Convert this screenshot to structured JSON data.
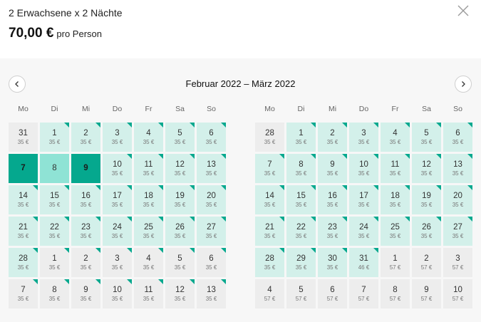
{
  "header": {
    "guests": "2 Erwachsene x 2 Nächte",
    "price": "70,00 €",
    "per": "pro Person"
  },
  "calendar": {
    "range_title": "Februar 2022 – März 2022",
    "weekdays": [
      "Mo",
      "Di",
      "Mi",
      "Do",
      "Fr",
      "Sa",
      "So"
    ]
  },
  "icons": {
    "close": "close-icon",
    "prev": "chevron-left-icon",
    "next": "chevron-right-icon"
  },
  "colors": {
    "accent": "#05a88e",
    "selected_mid": "#8fe3d5",
    "available": "#d3f0ea",
    "inactive": "#ededed"
  },
  "legend_types": {
    "a": "available",
    "n": "other month / unavailable",
    "s": "selected start/end",
    "m": "selected middle"
  },
  "months": [
    {
      "days": [
        [
          "31",
          "35 €",
          "n"
        ],
        [
          "1",
          "35 €",
          "a"
        ],
        [
          "2",
          "35 €",
          "a"
        ],
        [
          "3",
          "35 €",
          "a"
        ],
        [
          "4",
          "35 €",
          "a"
        ],
        [
          "5",
          "35 €",
          "a"
        ],
        [
          "6",
          "35 €",
          "a"
        ],
        [
          "7",
          "",
          "s"
        ],
        [
          "8",
          "",
          "m"
        ],
        [
          "9",
          "",
          "s"
        ],
        [
          "10",
          "35 €",
          "a"
        ],
        [
          "11",
          "35 €",
          "a"
        ],
        [
          "12",
          "35 €",
          "a"
        ],
        [
          "13",
          "35 €",
          "a"
        ],
        [
          "14",
          "35 €",
          "a"
        ],
        [
          "15",
          "35 €",
          "a"
        ],
        [
          "16",
          "35 €",
          "a"
        ],
        [
          "17",
          "35 €",
          "a"
        ],
        [
          "18",
          "35 €",
          "a"
        ],
        [
          "19",
          "35 €",
          "a"
        ],
        [
          "20",
          "35 €",
          "a"
        ],
        [
          "21",
          "35 €",
          "a"
        ],
        [
          "22",
          "35 €",
          "a"
        ],
        [
          "23",
          "35 €",
          "a"
        ],
        [
          "24",
          "35 €",
          "a"
        ],
        [
          "25",
          "35 €",
          "a"
        ],
        [
          "26",
          "35 €",
          "a"
        ],
        [
          "27",
          "35 €",
          "a"
        ],
        [
          "28",
          "35 €",
          "a"
        ],
        [
          "1",
          "35 €",
          "n"
        ],
        [
          "2",
          "35 €",
          "n"
        ],
        [
          "3",
          "35 €",
          "n"
        ],
        [
          "4",
          "35 €",
          "n"
        ],
        [
          "5",
          "35 €",
          "n"
        ],
        [
          "6",
          "35 €",
          "n"
        ],
        [
          "7",
          "35 €",
          "n"
        ],
        [
          "8",
          "35 €",
          "n"
        ],
        [
          "9",
          "35 €",
          "n"
        ],
        [
          "10",
          "35 €",
          "n"
        ],
        [
          "11",
          "35 €",
          "n"
        ],
        [
          "12",
          "35 €",
          "n"
        ],
        [
          "13",
          "35 €",
          "n"
        ]
      ],
      "triangles": [
        1,
        2,
        3,
        4,
        5,
        6,
        10,
        11,
        12,
        13,
        14,
        15,
        16,
        17,
        18,
        19,
        20,
        21,
        22,
        23,
        24,
        25,
        26,
        27,
        28,
        29,
        30,
        31,
        32,
        33,
        34,
        35,
        36,
        37,
        38,
        39,
        40,
        41
      ]
    },
    {
      "days": [
        [
          "28",
          "35 €",
          "n"
        ],
        [
          "1",
          "35 €",
          "a"
        ],
        [
          "2",
          "35 €",
          "a"
        ],
        [
          "3",
          "35 €",
          "a"
        ],
        [
          "4",
          "35 €",
          "a"
        ],
        [
          "5",
          "35 €",
          "a"
        ],
        [
          "6",
          "35 €",
          "a"
        ],
        [
          "7",
          "35 €",
          "a"
        ],
        [
          "8",
          "35 €",
          "a"
        ],
        [
          "9",
          "35 €",
          "a"
        ],
        [
          "10",
          "35 €",
          "a"
        ],
        [
          "11",
          "35 €",
          "a"
        ],
        [
          "12",
          "35 €",
          "a"
        ],
        [
          "13",
          "35 €",
          "a"
        ],
        [
          "14",
          "35 €",
          "a"
        ],
        [
          "15",
          "35 €",
          "a"
        ],
        [
          "16",
          "35 €",
          "a"
        ],
        [
          "17",
          "35 €",
          "a"
        ],
        [
          "18",
          "35 €",
          "a"
        ],
        [
          "19",
          "35 €",
          "a"
        ],
        [
          "20",
          "35 €",
          "a"
        ],
        [
          "21",
          "35 €",
          "a"
        ],
        [
          "22",
          "35 €",
          "a"
        ],
        [
          "23",
          "35 €",
          "a"
        ],
        [
          "24",
          "35 €",
          "a"
        ],
        [
          "25",
          "35 €",
          "a"
        ],
        [
          "26",
          "35 €",
          "a"
        ],
        [
          "27",
          "35 €",
          "a"
        ],
        [
          "28",
          "35 €",
          "a"
        ],
        [
          "29",
          "35 €",
          "a"
        ],
        [
          "30",
          "35 €",
          "a"
        ],
        [
          "31",
          "46 €",
          "a"
        ],
        [
          "1",
          "57 €",
          "n"
        ],
        [
          "2",
          "57 €",
          "n"
        ],
        [
          "3",
          "57 €",
          "n"
        ],
        [
          "4",
          "57 €",
          "n"
        ],
        [
          "5",
          "57 €",
          "n"
        ],
        [
          "6",
          "57 €",
          "n"
        ],
        [
          "7",
          "57 €",
          "n"
        ],
        [
          "8",
          "57 €",
          "n"
        ],
        [
          "9",
          "57 €",
          "n"
        ],
        [
          "10",
          "57 €",
          "n"
        ]
      ],
      "triangles": [
        1,
        2,
        3,
        4,
        5,
        6,
        7,
        8,
        9,
        10,
        11,
        12,
        13,
        14,
        15,
        16,
        17,
        18,
        19,
        20,
        21,
        22,
        23,
        24,
        25,
        26,
        27,
        28,
        29,
        30,
        31
      ]
    }
  ]
}
